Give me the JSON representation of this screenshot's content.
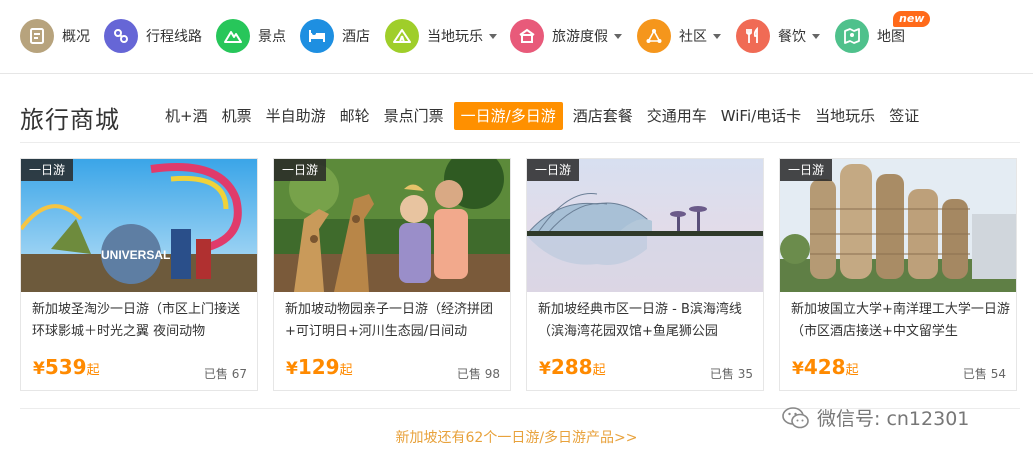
{
  "nav": {
    "items": [
      {
        "label": "概况",
        "icon": "overview-doc-icon",
        "color": "#b7a37d",
        "caret": false
      },
      {
        "label": "行程线路",
        "icon": "route-icon",
        "color": "#6666d6",
        "caret": false
      },
      {
        "label": "景点",
        "icon": "mountain-icon",
        "color": "#27c65a",
        "caret": false
      },
      {
        "label": "酒店",
        "icon": "bed-icon",
        "color": "#1e8fe1",
        "caret": false
      },
      {
        "label": "当地玩乐",
        "icon": "tent-icon",
        "color": "#9fce2a",
        "caret": true
      },
      {
        "label": "旅游度假",
        "icon": "vacation-icon",
        "color": "#e85a7a",
        "caret": true
      },
      {
        "label": "社区",
        "icon": "community-icon",
        "color": "#f5961c",
        "caret": true
      },
      {
        "label": "餐饮",
        "icon": "utensils-icon",
        "color": "#f06b55",
        "caret": true
      },
      {
        "label": "地图",
        "icon": "map-icon",
        "color": "#4fc18c",
        "caret": false,
        "badge": "new"
      }
    ]
  },
  "section": {
    "title": "旅行商城",
    "tabs": [
      {
        "label": "机+酒",
        "active": false
      },
      {
        "label": "机票",
        "active": false
      },
      {
        "label": "半自助游",
        "active": false
      },
      {
        "label": "邮轮",
        "active": false
      },
      {
        "label": "景点门票",
        "active": false
      },
      {
        "label": "一日游/多日游",
        "active": true
      },
      {
        "label": "酒店套餐",
        "active": false
      },
      {
        "label": "交通用车",
        "active": false
      },
      {
        "label": "WiFi/电话卡",
        "active": false
      },
      {
        "label": "当地玩乐",
        "active": false
      },
      {
        "label": "签证",
        "active": false
      }
    ]
  },
  "cards": [
    {
      "tag": "一日游",
      "title": "新加坡圣淘沙一日游（市区上门接送 环球影城＋时光之翼 夜间动物",
      "currency": "¥",
      "price": "539",
      "price_suffix": "起",
      "sold": "已售 67",
      "image": "theme-park-photo"
    },
    {
      "tag": "一日游",
      "title": "新加坡动物园亲子一日游（经济拼团+可订明日+河川生态园/日间动",
      "currency": "¥",
      "price": "129",
      "price_suffix": "起",
      "sold": "已售 98",
      "image": "giraffe-zoo-photo"
    },
    {
      "tag": "一日游",
      "title": "新加坡经典市区一日游 - B滨海湾线（滨海湾花园双馆+鱼尾狮公园",
      "currency": "¥",
      "price": "288",
      "price_suffix": "起",
      "sold": "已售 35",
      "image": "gardens-by-the-bay-photo"
    },
    {
      "tag": "一日游",
      "title": "新加坡国立大学+南洋理工大学一日游（市区酒店接送+中文留学生",
      "currency": "¥",
      "price": "428",
      "price_suffix": "起",
      "sold": "已售 54",
      "image": "university-building-photo"
    }
  ],
  "more_link": "新加坡还有62个一日游/多日游产品>>",
  "watermark": {
    "text": "微信号: cn12301",
    "icon": "wechat-icon"
  },
  "colors": {
    "accent": "#ff9000",
    "price": "#ff8a00",
    "link": "#e8a23c",
    "badge": "#ff6a1a"
  }
}
